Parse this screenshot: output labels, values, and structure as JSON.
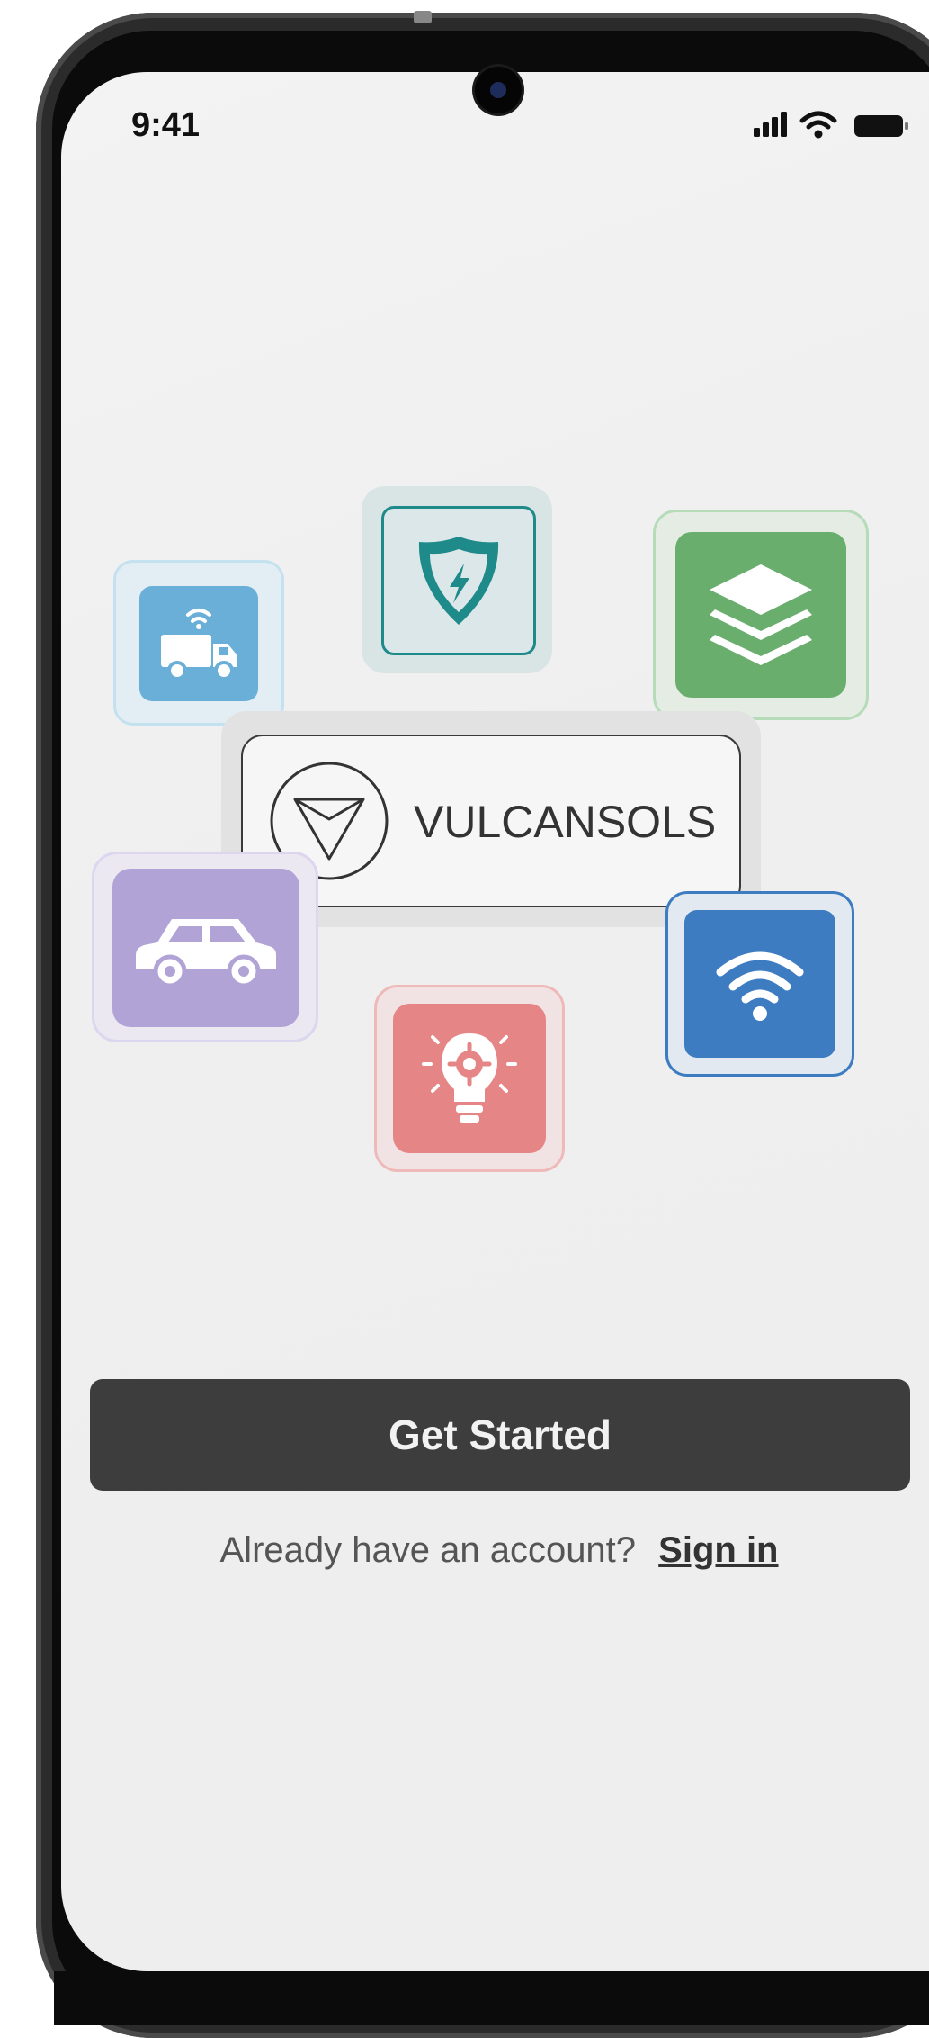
{
  "status_bar": {
    "time": "9:41",
    "icons": [
      "cellular-signal-icon",
      "wifi-icon",
      "battery-icon"
    ]
  },
  "feature_icons": [
    {
      "name": "connected-truck-icon",
      "color": "#6aafd8"
    },
    {
      "name": "security-shield-icon",
      "color": "#1f8a8a"
    },
    {
      "name": "layers-stack-icon",
      "color": "#6aae6e"
    },
    {
      "name": "car-icon",
      "color": "#b2a3d6"
    },
    {
      "name": "wifi-icon",
      "color": "#3d7cc0"
    },
    {
      "name": "smart-bulb-icon",
      "color": "#e58585"
    }
  ],
  "logo": {
    "text": "VULCANSOLS"
  },
  "actions": {
    "get_started_label": "Get Started",
    "account_prompt": "Already have an account?",
    "sign_in_label": "Sign in"
  },
  "colors": {
    "button_bg": "#3d3d3d",
    "screen_bg": "#efefef"
  }
}
